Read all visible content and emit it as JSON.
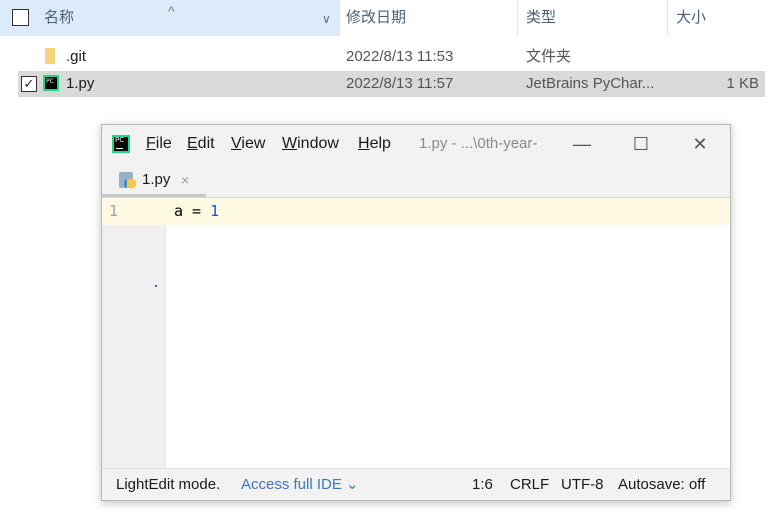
{
  "explorer": {
    "columns": {
      "name": "名称",
      "date": "修改日期",
      "type": "类型",
      "size": "大小"
    },
    "sort_indicator": "^",
    "dropdown_indicator": "∨",
    "files": [
      {
        "name": ".git",
        "date": "2022/8/13 11:53",
        "type": "文件夹",
        "size": ""
      },
      {
        "name": "1.py",
        "date": "2022/8/13 11:57",
        "type": "JetBrains PyChar...",
        "size": "1 KB",
        "checked": "✓"
      }
    ]
  },
  "lightedit": {
    "menu": {
      "file_u": "F",
      "file_rest": "ile",
      "edit_u": "E",
      "edit_rest": "dit",
      "view_u": "V",
      "view_rest": "iew",
      "window_u": "W",
      "window_rest": "indow",
      "help_u": "H",
      "help_rest": "elp"
    },
    "window_title": "1.py - ...\\0th-year-",
    "controls": {
      "minimize": "—",
      "maximize": "☐",
      "close": "✕"
    },
    "tab": {
      "label": "1.py",
      "close": "×"
    },
    "editor": {
      "line_number": "1",
      "code_prefix": "a = ",
      "code_number": "1"
    },
    "status": {
      "mode": "LightEdit mode.",
      "access_link": "Access full IDE",
      "access_chevron": "⌄",
      "position": "1:6",
      "line_ending": "CRLF",
      "encoding": "UTF-8",
      "autosave": "Autosave: off"
    },
    "colors": {
      "pycharm_green": "#21d789",
      "current_line": "#fffae3",
      "number_blue": "#1750eb",
      "link_blue": "#3b78c8"
    }
  }
}
